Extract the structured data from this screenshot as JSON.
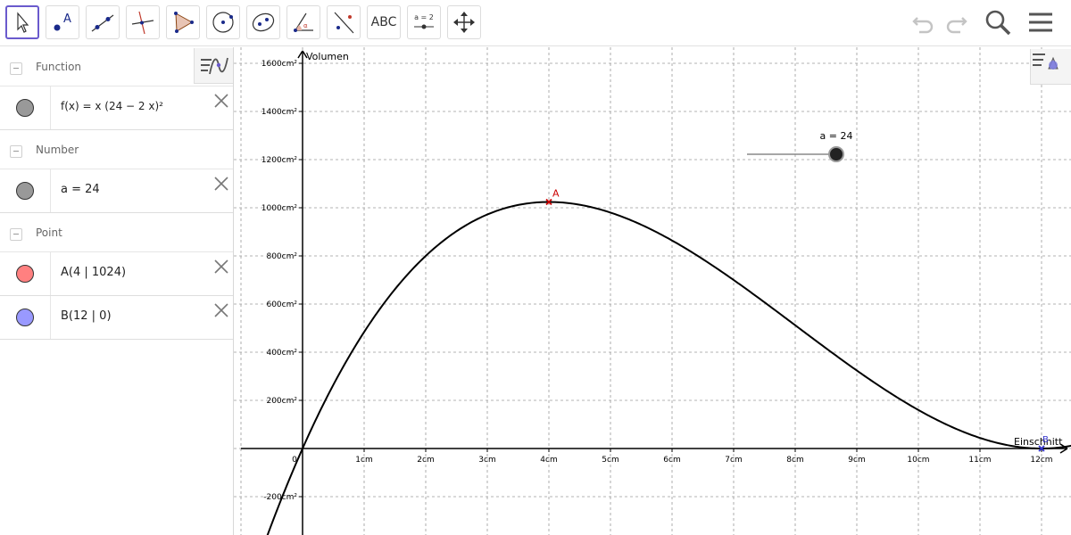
{
  "toolbar": {
    "tools": [
      {
        "name": "move-tool",
        "icon": "arrow-pointer-icon"
      },
      {
        "name": "point-tool",
        "icon": "point-icon"
      },
      {
        "name": "line-tool",
        "icon": "line-icon"
      },
      {
        "name": "perpendicular-tool",
        "icon": "perpendicular-icon"
      },
      {
        "name": "polygon-tool",
        "icon": "polygon-icon"
      },
      {
        "name": "circle-tool",
        "icon": "circle-center-icon"
      },
      {
        "name": "ellipse-tool",
        "icon": "ellipse-icon"
      },
      {
        "name": "angle-tool",
        "icon": "angle-icon"
      },
      {
        "name": "reflect-tool",
        "icon": "reflect-icon"
      },
      {
        "name": "text-tool",
        "icon": "text-icon",
        "label": "ABC"
      },
      {
        "name": "slider-tool",
        "icon": "slider-icon",
        "label": "a = 2"
      },
      {
        "name": "move-graphics-tool",
        "icon": "move-graphics-icon"
      }
    ],
    "undo_icon": "undo-icon",
    "redo_icon": "redo-icon",
    "search_icon": "search-icon",
    "menu_icon": "menu-icon"
  },
  "algebra": {
    "categories": [
      {
        "label": "Function",
        "items": [
          {
            "expr": "f(x) = x (24 − 2 x)²",
            "color": "#999999"
          }
        ]
      },
      {
        "label": "Number",
        "items": [
          {
            "expr": "a = 24",
            "color": "#999999"
          }
        ]
      },
      {
        "label": "Point",
        "items": [
          {
            "expr": "A(4 | 1024)",
            "color": "#ff8080"
          },
          {
            "expr": "B(12 | 0)",
            "color": "#9999ff"
          }
        ]
      }
    ]
  },
  "graph": {
    "x_axis_label": "Einschnitt",
    "y_axis_label": "Volumen",
    "x_ticks": [
      "0",
      "1cm",
      "2cm",
      "3cm",
      "4cm",
      "5cm",
      "6cm",
      "7cm",
      "8cm",
      "9cm",
      "10cm",
      "11cm",
      "12cm"
    ],
    "y_ticks": [
      "-200cm²",
      "200cm²",
      "400cm²",
      "600cm²",
      "800cm²",
      "1000cm²",
      "1200cm²",
      "1400cm²",
      "1600cm²"
    ],
    "slider_label": "a = 24",
    "point_A_label": "A",
    "point_B_label": "B",
    "colors": {
      "curve": "#000000",
      "point_A": "#cc0000",
      "point_B": "#3333cc",
      "grid": "#9a9a9a"
    }
  },
  "chart_data": {
    "type": "line",
    "function": "f(x) = x (24 − 2 x)²",
    "x": [
      -0.5,
      0,
      0.5,
      1,
      1.5,
      2,
      2.5,
      3,
      3.5,
      4,
      4.5,
      5,
      5.5,
      6,
      6.5,
      7,
      7.5,
      8,
      8.5,
      9,
      9.5,
      10,
      10.5,
      11,
      11.5,
      12
    ],
    "y": [
      -312.5,
      0,
      264.5,
      484,
      661.5,
      800,
      902.5,
      972,
      1011.5,
      1024,
      1012.5,
      980,
      930.5,
      864,
      786.5,
      700,
      607.5,
      512,
      416.5,
      324,
      237.5,
      160,
      94.5,
      44,
      11.5,
      0
    ],
    "points": [
      {
        "name": "A",
        "x": 4,
        "y": 1024
      },
      {
        "name": "B",
        "x": 12,
        "y": 0
      }
    ],
    "xlabel": "Einschnitt",
    "ylabel": "Volumen",
    "xlim": [
      -1,
      12.5
    ],
    "ylim": [
      -350,
      1700
    ],
    "grid": true
  }
}
